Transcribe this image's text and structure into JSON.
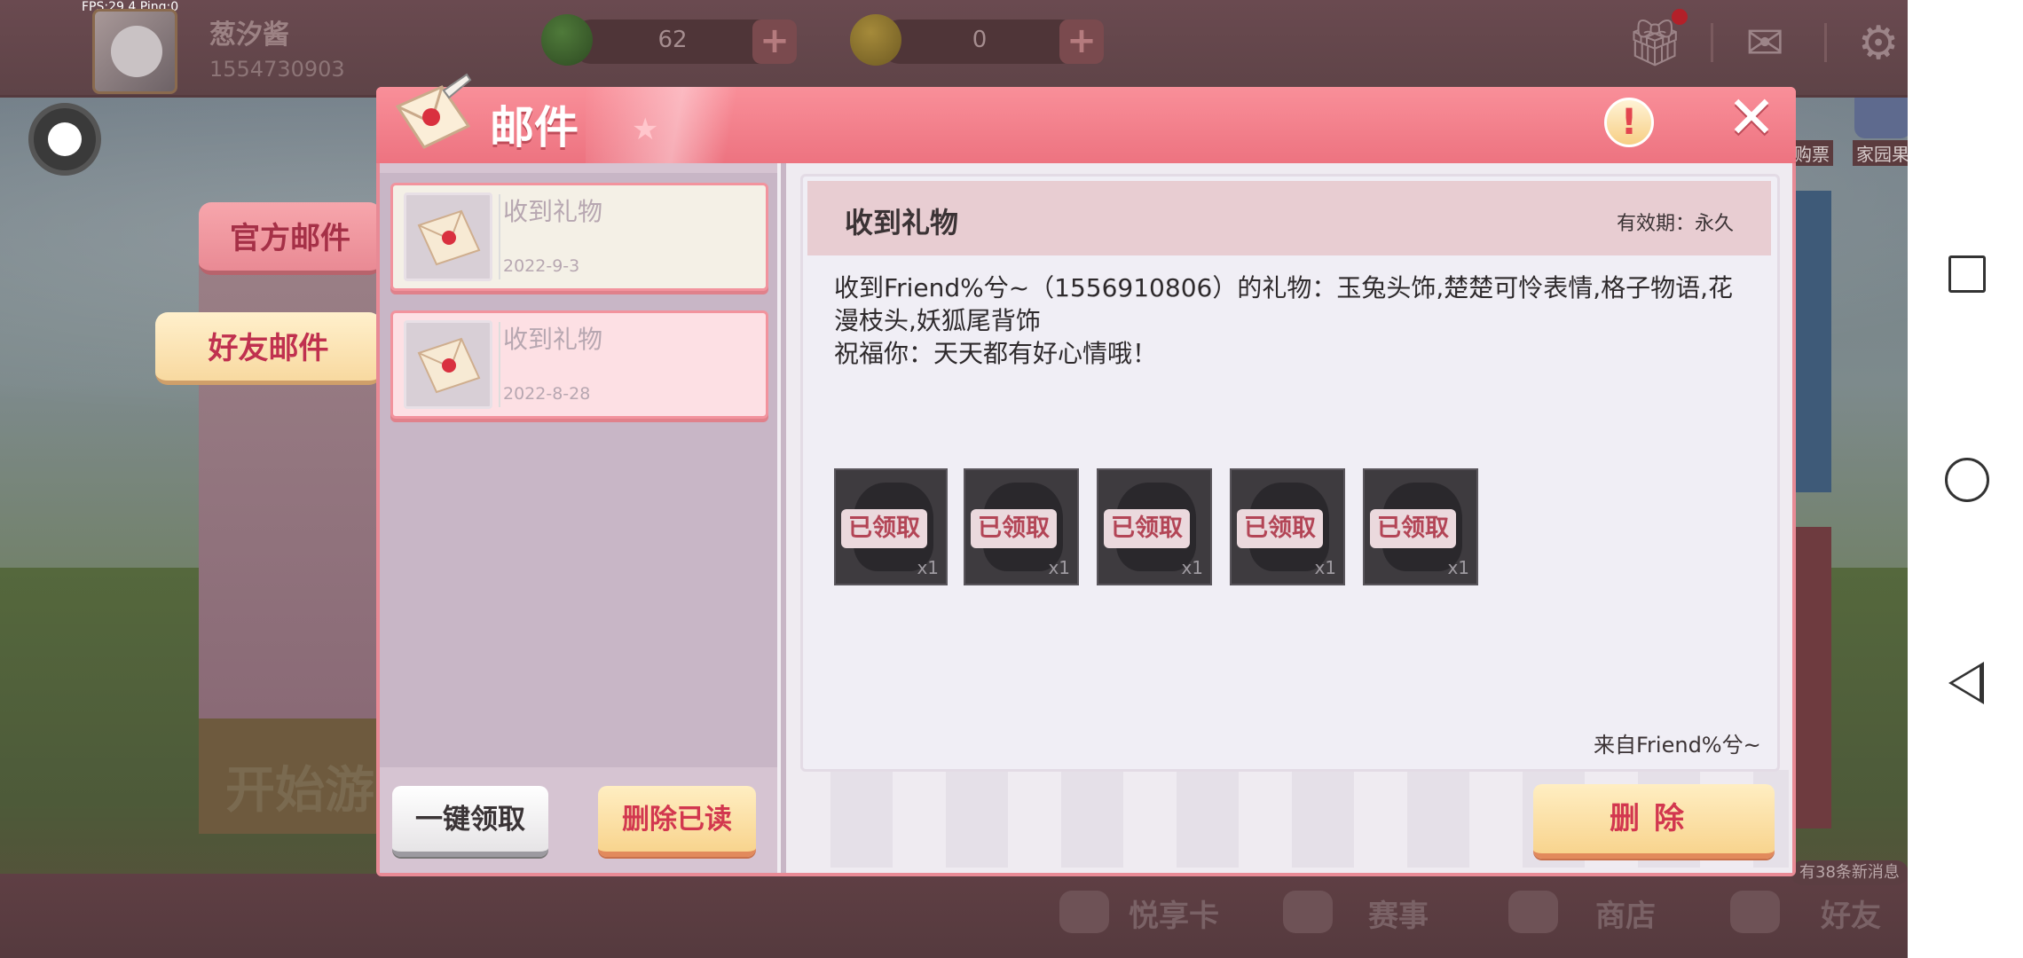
{
  "status": {
    "fps": "FPS:29.4",
    "ping": "Ping:0"
  },
  "profile": {
    "name": "葱汐酱",
    "id": "1554730903"
  },
  "resources": [
    {
      "icon": "green-gem-icon",
      "value": "62"
    },
    {
      "icon": "gold-coin-icon",
      "value": "0"
    }
  ],
  "background": {
    "label_ticket": "购票",
    "label_home": "家园果实",
    "start_label": "开始游",
    "new_messages": "有38条新消息",
    "bottom_nav": [
      "悦享卡",
      "赛事",
      "商店",
      "好友"
    ]
  },
  "categories": {
    "official": "官方邮件",
    "friend": "好友邮件"
  },
  "dialog": {
    "title": "邮件",
    "info_label": "!",
    "close_label": "✕"
  },
  "mail_list": [
    {
      "subject": "收到礼物",
      "date": "2022-9-3",
      "state": "read"
    },
    {
      "subject": "收到礼物",
      "date": "2022-8-28",
      "state": "selected"
    }
  ],
  "list_actions": {
    "claim_all": "一键领取",
    "delete_read": "删除已读"
  },
  "detail": {
    "title": "收到礼物",
    "validity": "有效期：永久",
    "body_line1": "收到Friend%兮~（1556910806）的礼物：玉兔头饰,楚楚可怜表情,格子物语,花漫枝头,妖狐尾背饰",
    "body_line2": "祝福你：天天都有好心情哦！",
    "sender": "来自Friend%兮~",
    "gifts": [
      {
        "status": "已领取",
        "qty": "x1"
      },
      {
        "status": "已领取",
        "qty": "x1"
      },
      {
        "status": "已领取",
        "qty": "x1"
      },
      {
        "status": "已领取",
        "qty": "x1"
      },
      {
        "status": "已领取",
        "qty": "x1"
      }
    ],
    "delete_label": "删除"
  },
  "colors": {
    "header": "#ed7380",
    "accent_red": "#d2374f",
    "button_yellow": "#f8d48e"
  }
}
